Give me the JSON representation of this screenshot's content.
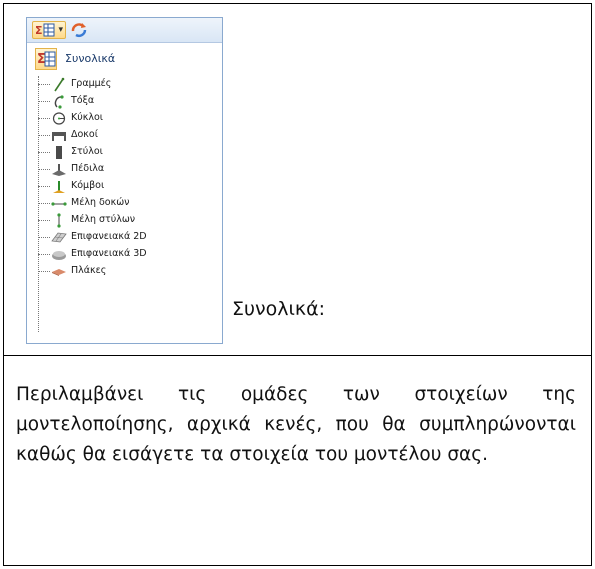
{
  "toolbar": {
    "sigma_icon": "sigma-table-icon",
    "dropdown_icon": "chevron-down-icon",
    "refresh_icon": "refresh-icon"
  },
  "panel": {
    "title": "Συνολικά",
    "items": [
      {
        "label": "Γραμμές",
        "icon": "line-icon"
      },
      {
        "label": "Τόξα",
        "icon": "arc-icon"
      },
      {
        "label": "Κύκλοι",
        "icon": "circle-icon"
      },
      {
        "label": "Δοκοί",
        "icon": "beam-icon"
      },
      {
        "label": "Στύλοι",
        "icon": "column-icon"
      },
      {
        "label": "Πέδιλα",
        "icon": "footing-icon"
      },
      {
        "label": "Κόμβοι",
        "icon": "node-icon"
      },
      {
        "label": "Μέλη δοκών",
        "icon": "beam-member-icon"
      },
      {
        "label": "Μέλη στύλων",
        "icon": "column-member-icon"
      },
      {
        "label": "Επιφανειακά 2D",
        "icon": "surface-2d-icon"
      },
      {
        "label": "Επιφανειακά 3D",
        "icon": "surface-3d-icon"
      },
      {
        "label": "Πλάκες",
        "icon": "slab-icon"
      }
    ]
  },
  "side_label": "Συνολικά:",
  "description": "Περιλαμβάνει τις ομάδες των στοιχείων της μοντελοποίησης, αρχικά κενές, που θα συμπληρώνονται καθώς θα εισάγετε τα στοιχεία του μοντέλου σας."
}
